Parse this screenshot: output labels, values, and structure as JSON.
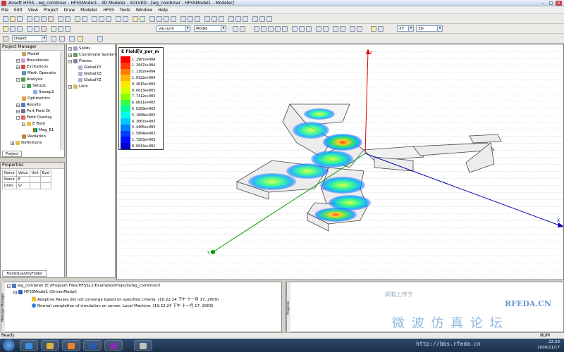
{
  "window": {
    "title": "Ansoft HFSS - wg_combiner - HFSSModel1 - 3D Modeler - SOLVED - [wg_combiner - HFSSModel1 - Modeler]"
  },
  "menu": [
    "File",
    "Edit",
    "View",
    "Project",
    "Draw",
    "Modeler",
    "HFSS",
    "Tools",
    "Window",
    "Help"
  ],
  "toolbar2": {
    "object_select": "Object",
    "material_select": "vacuum",
    "model_select": "Model",
    "plane_select": "XY",
    "view_select": "3D"
  },
  "project_manager": {
    "title": "Project Manager",
    "items": [
      "Model",
      "Boundaries",
      "Excitations",
      "Mesh Operatio",
      "Analysis",
      "Setup1",
      "Sweep1",
      "Optimetrics",
      "Results",
      "Port Field Di",
      "Field Overlay",
      "E Field",
      "Mag_E1",
      "Radiation",
      "Definitions"
    ],
    "tab": "Project"
  },
  "properties": {
    "title": "Properties",
    "headers": [
      "Name",
      "Value",
      "Unit",
      "Eval"
    ],
    "rows": [
      [
        "Name",
        "E",
        "",
        ""
      ],
      [
        "Units",
        "V/",
        "",
        ""
      ]
    ],
    "tab": "FieldsQuantityFolder"
  },
  "model_tree": {
    "items": [
      "Solids",
      "Coordinate Systems",
      "Planes",
      "GlobalXY",
      "GlobalXZ",
      "GlobalYZ",
      "Lists"
    ]
  },
  "legend": {
    "title": "E Field[V_per_m",
    "values": [
      "1.2907e+004",
      "1.2047e+004",
      "1.1182e+004",
      "1.0322e+004",
      "9.4615e+003",
      "8.6013e+003",
      "7.7412e+003",
      "6.8811e+003",
      "6.0209e+003",
      "5.1608e+003",
      "4.3007e+003",
      "3.4405e+003",
      "2.5804e+003",
      "1.7203e+003",
      "8.6014e+002"
    ],
    "colors": [
      "#ff0000",
      "#ff3a00",
      "#ff7a00",
      "#ffb400",
      "#ffe600",
      "#d9ff00",
      "#8cff00",
      "#33ff4a",
      "#00ff9c",
      "#00ffe6",
      "#00c8ff",
      "#0080ff",
      "#0040ff",
      "#0010ff",
      "#0000cc"
    ]
  },
  "axes": {
    "z": "Z",
    "x": "X",
    "y": "Y"
  },
  "messages": {
    "line1": "wg_combiner (E:/Program Files/HFSS12/Examples/Projects/wg_combiner/)",
    "line2": "HFSSModel1 (DrivenModal)",
    "line3": "Adaptive Passes did not converge based on specified criteria. (10:22:24 下午  十一月 17, 2009)",
    "line4": "Normal completion of simulation on server: Local Machine. (10:22:24 下午  十一月 17, 2009)"
  },
  "vtabs": {
    "message": "Message Manager",
    "progress": "Progress"
  },
  "status": {
    "left": "Ready",
    "num": "NUM"
  },
  "clock": {
    "time": "22:29",
    "date": "2009/11/17"
  },
  "watermark": {
    "top": "网有上传于",
    "brand": "RFEDA.CN",
    "chinese": "微 波 仿 真 论 坛",
    "url": "http://bbs.rfeda.cn"
  }
}
